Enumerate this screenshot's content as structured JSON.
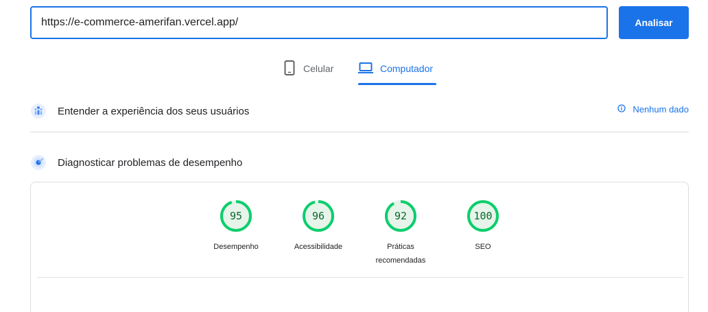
{
  "search": {
    "url_value": "https://e-commerce-amerifan.vercel.app/",
    "analyze_label": "Analisar"
  },
  "tabs": [
    {
      "label": "Celular",
      "icon": "smartphone-icon",
      "selected": false
    },
    {
      "label": "Computador",
      "icon": "laptop-icon",
      "selected": true
    }
  ],
  "sections": {
    "ux": {
      "title": "Entender a experiência dos seus usuários",
      "icon": "users-icon",
      "no_data_label": "Nenhum dado"
    },
    "perf": {
      "title": "Diagnosticar problemas de desempenho",
      "icon": "lighthouse-icon"
    }
  },
  "scores": [
    {
      "value": "95",
      "label": "Desempenho"
    },
    {
      "value": "96",
      "label": "Acessibilidade"
    },
    {
      "value": "92",
      "label": "Práticas\nrecomendadas"
    },
    {
      "value": "100",
      "label": "SEO"
    }
  ],
  "colors": {
    "accent": "#1a73e8",
    "pass": "#0cce6b",
    "pass_text": "#0d652d",
    "pass_bg": "#e6f4ea"
  }
}
